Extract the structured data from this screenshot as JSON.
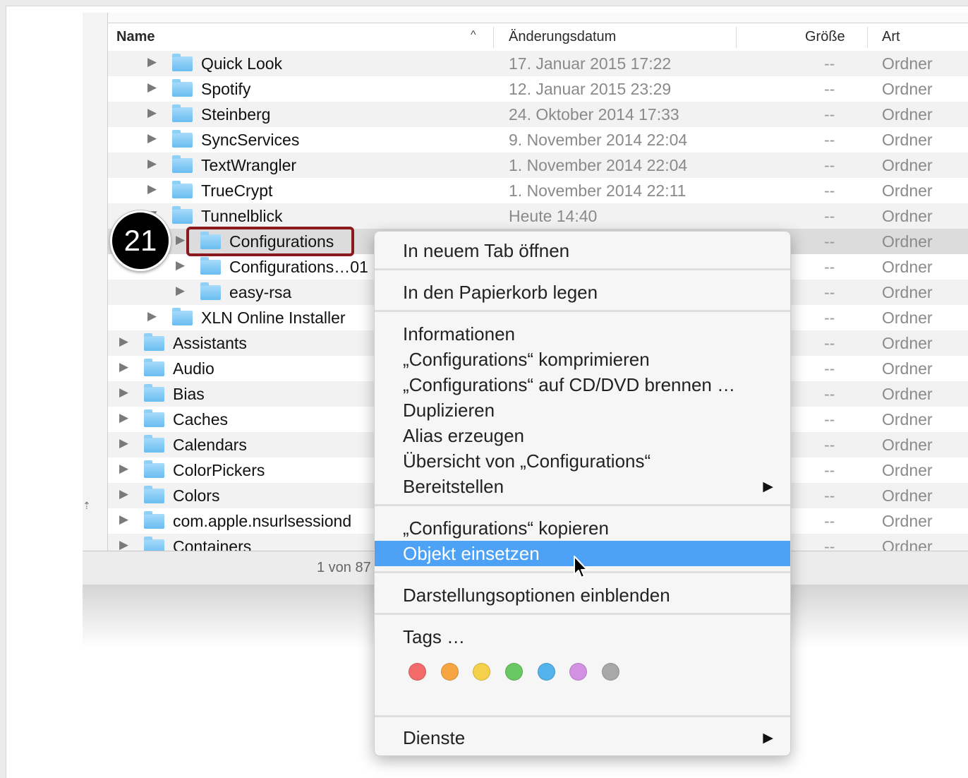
{
  "header": {
    "name": "Name",
    "sort_indicator": "^",
    "date": "Änderungsdatum",
    "size": "Größe",
    "kind": "Art"
  },
  "rows": [
    {
      "name": "Quick Look",
      "date": "17. Januar 2015 17:22",
      "size": "--",
      "kind": "Ordner"
    },
    {
      "name": "Spotify",
      "date": "12. Januar 2015 23:29",
      "size": "--",
      "kind": "Ordner"
    },
    {
      "name": "Steinberg",
      "date": "24. Oktober 2014 17:33",
      "size": "--",
      "kind": "Ordner"
    },
    {
      "name": "SyncServices",
      "date": "9. November 2014 22:04",
      "size": "--",
      "kind": "Ordner"
    },
    {
      "name": "TextWrangler",
      "date": "1. November 2014 22:04",
      "size": "--",
      "kind": "Ordner"
    },
    {
      "name": "TrueCrypt",
      "date": "1. November 2014 22:11",
      "size": "--",
      "kind": "Ordner"
    },
    {
      "name": "Tunnelblick",
      "date": "Heute 14:40",
      "size": "--",
      "kind": "Ordner"
    },
    {
      "name": "Configurations",
      "date": "",
      "size": "--",
      "kind": "Ordner"
    },
    {
      "name": "Configurations…01",
      "date": "",
      "size": "--",
      "kind": "Ordner"
    },
    {
      "name": "easy-rsa",
      "date": "",
      "size": "--",
      "kind": "Ordner"
    },
    {
      "name": "XLN Online Installer",
      "date": "",
      "size": "--",
      "kind": "Ordner"
    },
    {
      "name": "Assistants",
      "date": "",
      "size": "--",
      "kind": "Ordner"
    },
    {
      "name": "Audio",
      "date": "",
      "size": "--",
      "kind": "Ordner"
    },
    {
      "name": "Bias",
      "date": "",
      "size": "--",
      "kind": "Ordner"
    },
    {
      "name": "Caches",
      "date": "",
      "size": "--",
      "kind": "Ordner"
    },
    {
      "name": "Calendars",
      "date": "",
      "size": "--",
      "kind": "Ordner"
    },
    {
      "name": "ColorPickers",
      "date": "",
      "size": "--",
      "kind": "Ordner"
    },
    {
      "name": "Colors",
      "date": "",
      "size": "--",
      "kind": "Ordner"
    },
    {
      "name": "com.apple.nsurlsessiond",
      "date": "",
      "size": "--",
      "kind": "Ordner"
    },
    {
      "name": "Containers",
      "date": "",
      "size": "--",
      "kind": "Ordner"
    }
  ],
  "status_bar": {
    "text": "1 von 87"
  },
  "step_badge": {
    "number": "21"
  },
  "context_menu": {
    "open_new_tab": "In neuem Tab öffnen",
    "move_to_trash": "In den Papierkorb legen",
    "get_info": "Informationen",
    "compress": "„Configurations“ komprimieren",
    "burn": "„Configurations“ auf CD/DVD brennen …",
    "duplicate": "Duplizieren",
    "make_alias": "Alias erzeugen",
    "quick_look": "Übersicht von „Configurations“",
    "share": "Bereitstellen",
    "copy": "„Configurations“ kopieren",
    "paste": "Objekt einsetzen",
    "view_options": "Darstellungsoptionen einblenden",
    "tags": "Tags …",
    "services": "Dienste",
    "submenu_arrow": "▶"
  },
  "tag_colors": [
    "#f26b6a",
    "#f6a541",
    "#f5d04a",
    "#6ac862",
    "#53b3ec",
    "#d391e4",
    "#a8a8a8"
  ],
  "colors": {
    "selection_accent": "#4da2f5",
    "annotation_outline": "#8b1a1f",
    "folder_blue": "#69bdf2"
  },
  "icons": {
    "disclosure": "disclosure-triangle-icon",
    "folder": "folder-icon",
    "cursor": "mouse-pointer-icon"
  }
}
